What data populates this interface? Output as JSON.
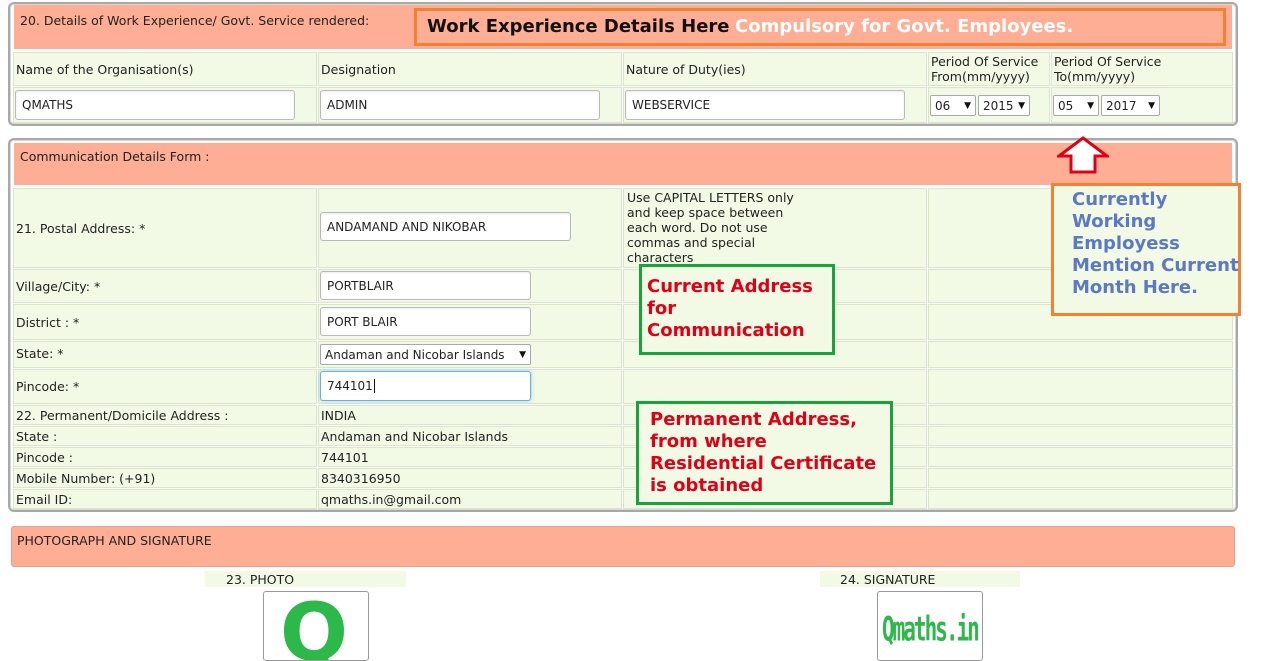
{
  "work": {
    "header": "20. Details of Work Experience/ Govt. Service rendered:",
    "banner_bold": "Work Experience Details Here",
    "banner_light": "Compulsory for Govt. Employees.",
    "columns": [
      "Name of the Organisation(s)",
      "Designation",
      "Nature of Duty(ies)",
      "Period Of Service From(mm/yyyy)",
      "Period Of Service To(mm/yyyy)"
    ],
    "organisation": "QMATHS",
    "designation": "ADMIN",
    "duty": "WEBSERVICE",
    "from_month": "06",
    "from_year": "2015",
    "to_month": "05",
    "to_year": "2017"
  },
  "comm": {
    "header": "Communication Details Form :",
    "postal_label": "21. Postal Address: *",
    "postal_value": "ANDAMAND AND NIKOBAR",
    "postal_note": "Use CAPITAL LETTERS only and keep space between each word. Do not use commas and special characters",
    "village_label": "Village/City: *",
    "village_value": "PORTBLAIR",
    "district_label": "District : *",
    "district_value": "PORT BLAIR",
    "state_label": "State: *",
    "state_value": "Andaman and Nicobar Islands",
    "pincode_label": "Pincode: *",
    "pincode_value": "744101",
    "perm_label": "22. Permanent/Domicile Address :",
    "perm_value": "INDIA",
    "perm_state_label": "State :",
    "perm_state_value": "Andaman and Nicobar Islands",
    "perm_pin_label": "Pincode :",
    "perm_pin_value": "744101",
    "mobile_label": "Mobile Number: (+91)",
    "mobile_value": "8340316950",
    "email_label": "Email ID:",
    "email_value": "qmaths.in@gmail.com"
  },
  "annotations": {
    "current_address": "Current Address for Communication",
    "permanent_address": "Permanent Address, from where Residential Certificate is obtained",
    "currently_working": "Currently Working Employess Mention Current Month Here."
  },
  "photo": {
    "header": "PHOTOGRAPH AND SIGNATURE",
    "photo_label": "23. PHOTO",
    "signature_label": "24. SIGNATURE",
    "photo_logo": "Q",
    "signature_text": "Qmaths.in"
  },
  "colors": {
    "header_bg": "#fdae94",
    "cell_bg": "#f2f9e4",
    "annotation_green": "#1aa33a",
    "annotation_red": "#e00016",
    "annotation_orange": "#f28233",
    "annotation_blue": "#5b79c4",
    "logo_green": "#2db84a"
  }
}
